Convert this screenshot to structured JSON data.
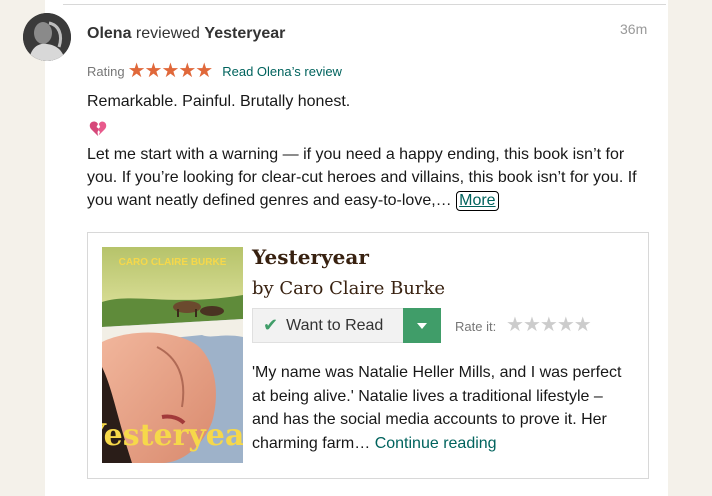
{
  "review": {
    "reviewer": "Olena",
    "action": "reviewed",
    "book": "Yesteryear",
    "time": "36m",
    "rating_label": "Rating",
    "rating_value": 5,
    "rating_stars": "★★★★★",
    "read_review_link": "Read Olena’s review",
    "title_line": "Remarkable. Painful. Brutally honest.",
    "body": "Let me start with a warning — if you need a happy ending, this book isn’t for you. If you’re looking for clear-cut heroes and villains, this book isn’t for you. If you want neatly defined genres and easy-to-love,…",
    "more_button": "More"
  },
  "book_card": {
    "title": "Yesteryear",
    "author": "by Caro Claire Burke",
    "want_to_read_label": "Want to Read",
    "check_icon": "✔",
    "rate_label": "Rate it:",
    "rate_stars": [
      "★",
      "★",
      "★",
      "★",
      "★"
    ],
    "description": "'My name was Natalie Heller Mills, and I was perfect at being alive.' Natalie lives a traditional lifestyle – and has the social media accounts to prove it. Her charming farm…",
    "continue_link": "Continue reading",
    "cover": {
      "author_text": "CARO CLAIRE BURKE",
      "title_text": "Yesteryear"
    }
  },
  "colors": {
    "accent_green": "#409d69",
    "link_teal": "#00635d",
    "star_orange": "#e0683a",
    "star_empty": "#cccccc"
  }
}
